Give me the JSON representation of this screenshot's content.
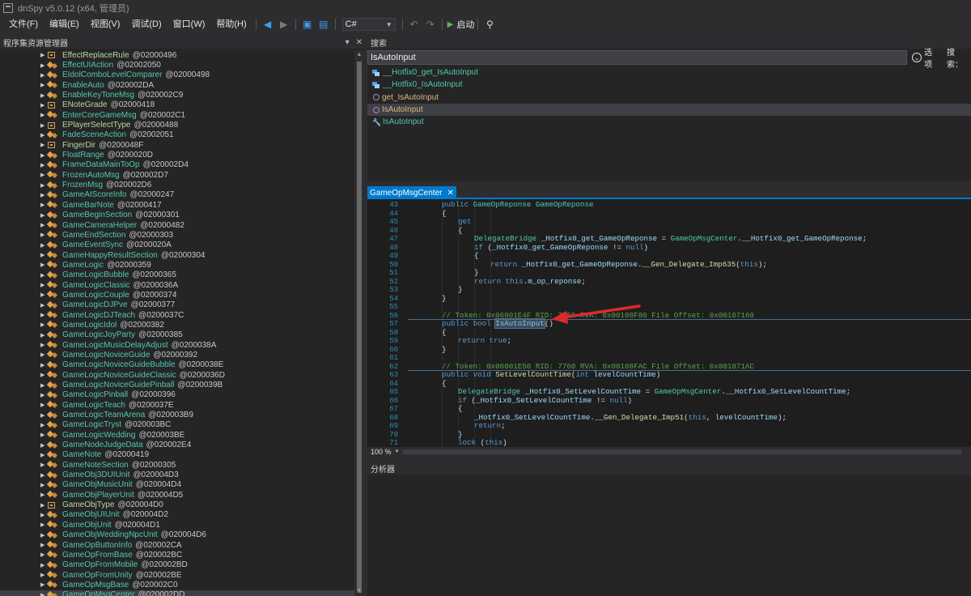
{
  "window": {
    "title": "dnSpy v5.0.12 (x64, 管理员)"
  },
  "menu": [
    "文件(F)",
    "编辑(E)",
    "视图(V)",
    "调试(D)",
    "窗口(W)",
    "帮助(H)"
  ],
  "toolbar": {
    "language": "C#",
    "start_label": "启动"
  },
  "tree": {
    "title": "程序集资源管理器",
    "items": [
      {
        "name": "EffectReplaceRule",
        "rid": "@02000496",
        "kind": "enum"
      },
      {
        "name": "EffectUIAction",
        "rid": "@02002050",
        "kind": "class"
      },
      {
        "name": "EIdolComboLevelComparer",
        "rid": "@02000498",
        "kind": "class"
      },
      {
        "name": "EnableAuto",
        "rid": "@020002DA",
        "kind": "class"
      },
      {
        "name": "EnableKeyToneMsg",
        "rid": "@020002C9",
        "kind": "class"
      },
      {
        "name": "ENoteGrade",
        "rid": "@02000418",
        "kind": "enum"
      },
      {
        "name": "EnterCoreGameMsg",
        "rid": "@020002C1",
        "kind": "class"
      },
      {
        "name": "EPlayerSelectType",
        "rid": "@02000488",
        "kind": "enum"
      },
      {
        "name": "FadeSceneAction",
        "rid": "@02002051",
        "kind": "class"
      },
      {
        "name": "FingerDir",
        "rid": "@0200048F",
        "kind": "enum"
      },
      {
        "name": "FloatRange",
        "rid": "@0200020D",
        "kind": "class"
      },
      {
        "name": "FrameDataMainToOp",
        "rid": "@020002D4",
        "kind": "class"
      },
      {
        "name": "FrozenAutoMsg",
        "rid": "@020002D7",
        "kind": "class"
      },
      {
        "name": "FrozenMsg",
        "rid": "@020002D6",
        "kind": "class"
      },
      {
        "name": "GameAIScoreInfo",
        "rid": "@02000247",
        "kind": "class"
      },
      {
        "name": "GameBarNote",
        "rid": "@02000417",
        "kind": "class"
      },
      {
        "name": "GameBeginSection",
        "rid": "@02000301",
        "kind": "class"
      },
      {
        "name": "GameCameraHelper",
        "rid": "@02000482",
        "kind": "class"
      },
      {
        "name": "GameEndSection",
        "rid": "@02000303",
        "kind": "class"
      },
      {
        "name": "GameEventSync",
        "rid": "@0200020A",
        "kind": "class"
      },
      {
        "name": "GameHappyResultSection",
        "rid": "@02000304",
        "kind": "class"
      },
      {
        "name": "GameLogic",
        "rid": "@02000359",
        "kind": "class"
      },
      {
        "name": "GameLogicBubble",
        "rid": "@02000365",
        "kind": "class"
      },
      {
        "name": "GameLogicClassic",
        "rid": "@0200036A",
        "kind": "class"
      },
      {
        "name": "GameLogicCouple",
        "rid": "@02000374",
        "kind": "class"
      },
      {
        "name": "GameLogicDJPve",
        "rid": "@02000377",
        "kind": "class"
      },
      {
        "name": "GameLogicDJTeach",
        "rid": "@0200037C",
        "kind": "class"
      },
      {
        "name": "GameLogicIdol",
        "rid": "@02000382",
        "kind": "class"
      },
      {
        "name": "GameLogicJoyParty",
        "rid": "@02000385",
        "kind": "class"
      },
      {
        "name": "GameLogicMusicDelayAdjust",
        "rid": "@0200038A",
        "kind": "class"
      },
      {
        "name": "GameLogicNoviceGuide",
        "rid": "@02000392",
        "kind": "class"
      },
      {
        "name": "GameLogicNoviceGuideBubble",
        "rid": "@0200038E",
        "kind": "class"
      },
      {
        "name": "GameLogicNoviceGuideClassic",
        "rid": "@0200036D",
        "kind": "class"
      },
      {
        "name": "GameLogicNoviceGuidePinball",
        "rid": "@0200039B",
        "kind": "class"
      },
      {
        "name": "GameLogicPinball",
        "rid": "@02000396",
        "kind": "class"
      },
      {
        "name": "GameLogicTeach",
        "rid": "@0200037E",
        "kind": "class"
      },
      {
        "name": "GameLogicTeamArena",
        "rid": "@020003B9",
        "kind": "class"
      },
      {
        "name": "GameLogicTryst",
        "rid": "@020003BC",
        "kind": "class"
      },
      {
        "name": "GameLogicWedding",
        "rid": "@020003BE",
        "kind": "class"
      },
      {
        "name": "GameNodeJudgeData",
        "rid": "@020002E4",
        "kind": "class"
      },
      {
        "name": "GameNote",
        "rid": "@02000419",
        "kind": "class"
      },
      {
        "name": "GameNoteSection",
        "rid": "@02000305",
        "kind": "class"
      },
      {
        "name": "GameObj3DUIUnit",
        "rid": "@020004D3",
        "kind": "class"
      },
      {
        "name": "GameObjMusicUnit",
        "rid": "@020004D4",
        "kind": "class"
      },
      {
        "name": "GameObjPlayerUnit",
        "rid": "@020004D5",
        "kind": "class"
      },
      {
        "name": "GameObjType",
        "rid": "@020004D0",
        "kind": "enum"
      },
      {
        "name": "GameObjUIUnit",
        "rid": "@020004D2",
        "kind": "class"
      },
      {
        "name": "GameObjUnit",
        "rid": "@020004D1",
        "kind": "class"
      },
      {
        "name": "GameObjWeddingNpcUnit",
        "rid": "@020004D6",
        "kind": "class"
      },
      {
        "name": "GameOpButtonInfo",
        "rid": "@020002CA",
        "kind": "class"
      },
      {
        "name": "GameOpFromBase",
        "rid": "@020002BC",
        "kind": "class"
      },
      {
        "name": "GameOpFromMobile",
        "rid": "@020002BD",
        "kind": "class"
      },
      {
        "name": "GameOpFromUnity",
        "rid": "@020002BE",
        "kind": "class"
      },
      {
        "name": "GameOpMsgBase",
        "rid": "@020002C0",
        "kind": "class"
      },
      {
        "name": "GameOpMsgCenter",
        "rid": "@020002DD",
        "kind": "class"
      }
    ]
  },
  "search": {
    "title": "搜索",
    "query": "IsAutoInput",
    "options_label": "选项",
    "search_label": "搜索：",
    "results": [
      {
        "name": "__Hotfix0_get_IsAutoInput",
        "kind": "field"
      },
      {
        "name": "__Hotfix0_IsAutoInput",
        "kind": "field"
      },
      {
        "name": "get_IsAutoInput",
        "kind": "method"
      },
      {
        "name": "IsAutoInput",
        "kind": "method"
      },
      {
        "name": "IsAutoInput",
        "kind": "property"
      }
    ]
  },
  "editor": {
    "tab": "GameOpMsgCenter",
    "zoom": "100 %",
    "lines": [
      {
        "n": "43",
        "indent": 0,
        "segs": [
          [
            "kw",
            "public "
          ],
          [
            "ty",
            "GameOpReponse "
          ],
          [
            "ty",
            "GameOpReponse"
          ]
        ]
      },
      {
        "n": "44",
        "indent": 0,
        "segs": [
          [
            "pl",
            "{"
          ]
        ]
      },
      {
        "n": "45",
        "indent": 1,
        "segs": [
          [
            "kw",
            "get"
          ]
        ]
      },
      {
        "n": "46",
        "indent": 1,
        "segs": [
          [
            "pl",
            "{"
          ]
        ]
      },
      {
        "n": "47",
        "indent": 2,
        "segs": [
          [
            "ty",
            "DelegateBridge "
          ],
          [
            "nm",
            "_Hotfix0_get_GameOpReponse "
          ],
          [
            "pl",
            "= "
          ],
          [
            "ty",
            "GameOpMsgCenter"
          ],
          [
            "pl",
            "."
          ],
          [
            "nm",
            "__Hotfix0_get_GameOpReponse"
          ],
          [
            "pl",
            ";"
          ]
        ]
      },
      {
        "n": "48",
        "indent": 2,
        "segs": [
          [
            "kw",
            "if "
          ],
          [
            "pl",
            "("
          ],
          [
            "nm",
            "_Hotfix0_get_GameOpReponse "
          ],
          [
            "pl",
            "!= "
          ],
          [
            "kw",
            "null"
          ],
          [
            "pl",
            ")"
          ]
        ]
      },
      {
        "n": "49",
        "indent": 2,
        "segs": [
          [
            "pl",
            "{"
          ]
        ]
      },
      {
        "n": "50",
        "indent": 3,
        "segs": [
          [
            "kw",
            "return "
          ],
          [
            "nm",
            "_Hotfix0_get_GameOpReponse"
          ],
          [
            "pl",
            "."
          ],
          [
            "mt",
            "__Gen_Delegate_Imp635"
          ],
          [
            "pl",
            "("
          ],
          [
            "kw",
            "this"
          ],
          [
            "pl",
            ");"
          ]
        ]
      },
      {
        "n": "51",
        "indent": 2,
        "segs": [
          [
            "pl",
            "}"
          ]
        ]
      },
      {
        "n": "52",
        "indent": 2,
        "segs": [
          [
            "kw",
            "return "
          ],
          [
            "kw",
            "this"
          ],
          [
            "pl",
            "."
          ],
          [
            "nm",
            "m_op_reponse"
          ],
          [
            "pl",
            ";"
          ]
        ]
      },
      {
        "n": "53",
        "indent": 1,
        "segs": [
          [
            "pl",
            "}"
          ]
        ]
      },
      {
        "n": "54",
        "indent": 0,
        "segs": [
          [
            "pl",
            "}"
          ]
        ]
      },
      {
        "n": "55",
        "indent": 0,
        "segs": []
      },
      {
        "n": "56",
        "indent": 0,
        "segs": [
          [
            "cm",
            "// Token: 0x06001E4F RID: 7759 RVA: 0x00108F80 File Offset: 0x00107160"
          ]
        ]
      },
      {
        "n": "57",
        "indent": 0,
        "segs": [
          [
            "kw",
            "public "
          ],
          [
            "kw",
            "bool "
          ],
          [
            "hl",
            "IsAutoInput"
          ],
          [
            "pl",
            "()"
          ]
        ]
      },
      {
        "n": "58",
        "indent": 0,
        "segs": [
          [
            "pl",
            "{"
          ]
        ]
      },
      {
        "n": "59",
        "indent": 1,
        "segs": [
          [
            "kw",
            "return "
          ],
          [
            "kw",
            "true"
          ],
          [
            "pl",
            ";"
          ]
        ]
      },
      {
        "n": "60",
        "indent": 0,
        "segs": [
          [
            "pl",
            "}"
          ]
        ]
      },
      {
        "n": "61",
        "indent": 0,
        "segs": []
      },
      {
        "n": "62",
        "indent": 0,
        "segs": [
          [
            "cm",
            "// Token: 0x06001E50 RID: 7760 RVA: 0x00108FAC File Offset: 0x001071AC"
          ]
        ]
      },
      {
        "n": "63",
        "indent": 0,
        "segs": [
          [
            "kw",
            "public "
          ],
          [
            "kw",
            "void "
          ],
          [
            "mt",
            "SetLevelCountTime"
          ],
          [
            "pl",
            "("
          ],
          [
            "kw",
            "int "
          ],
          [
            "nm",
            "levelCountTime"
          ],
          [
            "pl",
            ")"
          ]
        ]
      },
      {
        "n": "64",
        "indent": 0,
        "segs": [
          [
            "pl",
            "{"
          ]
        ]
      },
      {
        "n": "65",
        "indent": 1,
        "segs": [
          [
            "ty",
            "DelegateBridge "
          ],
          [
            "nm",
            "_Hotfix0_SetLevelCountTime "
          ],
          [
            "pl",
            "= "
          ],
          [
            "ty",
            "GameOpMsgCenter"
          ],
          [
            "pl",
            "."
          ],
          [
            "nm",
            "__Hotfix0_SetLevelCountTime"
          ],
          [
            "pl",
            ";"
          ]
        ]
      },
      {
        "n": "66",
        "indent": 1,
        "segs": [
          [
            "kw",
            "if "
          ],
          [
            "pl",
            "("
          ],
          [
            "nm",
            "_Hotfix0_SetLevelCountTime "
          ],
          [
            "pl",
            "!= "
          ],
          [
            "kw",
            "null"
          ],
          [
            "pl",
            ")"
          ]
        ]
      },
      {
        "n": "67",
        "indent": 1,
        "segs": [
          [
            "pl",
            "{"
          ]
        ]
      },
      {
        "n": "68",
        "indent": 2,
        "segs": [
          [
            "nm",
            "_Hotfix0_SetLevelCountTime"
          ],
          [
            "pl",
            "."
          ],
          [
            "mt",
            "__Gen_Delegate_Imp51"
          ],
          [
            "pl",
            "("
          ],
          [
            "kw",
            "this"
          ],
          [
            "pl",
            ", "
          ],
          [
            "nm",
            "levelCountTime"
          ],
          [
            "pl",
            ");"
          ]
        ]
      },
      {
        "n": "69",
        "indent": 2,
        "segs": [
          [
            "kw",
            "return"
          ],
          [
            "pl",
            ";"
          ]
        ]
      },
      {
        "n": "70",
        "indent": 1,
        "segs": [
          [
            "pl",
            "}"
          ]
        ]
      },
      {
        "n": "71",
        "indent": 1,
        "segs": [
          [
            "kw",
            "lock "
          ],
          [
            "pl",
            "("
          ],
          [
            "kw",
            "this"
          ],
          [
            "pl",
            ")"
          ]
        ]
      }
    ]
  },
  "analyzer": {
    "title": "分析器"
  },
  "colors": {
    "accent": "#007acc",
    "arrow": "#e0282c",
    "background": "#1e1e1e"
  }
}
